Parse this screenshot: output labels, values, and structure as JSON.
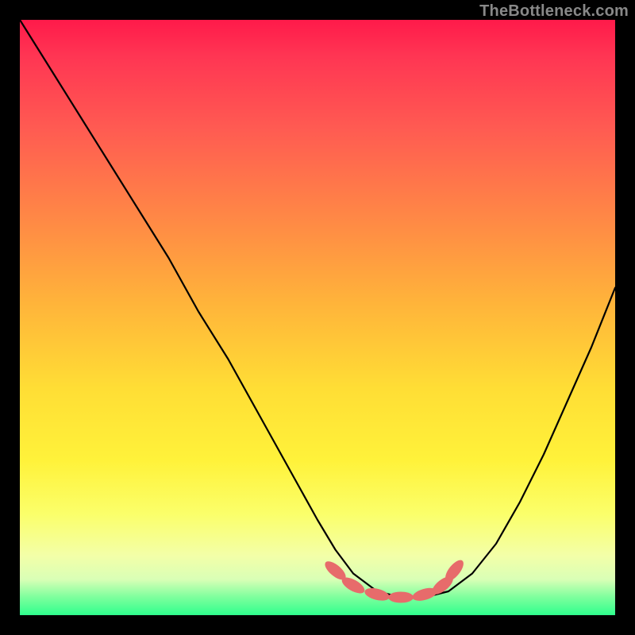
{
  "watermark": "TheBottleneck.com",
  "colors": {
    "page_bg": "#000000",
    "gradient_top": "#ff1a4a",
    "gradient_bottom": "#2fff8d",
    "curve": "#000000",
    "marker": "#e76b6b"
  },
  "chart_data": {
    "type": "line",
    "title": "",
    "xlabel": "",
    "ylabel": "",
    "xlim": [
      0,
      100
    ],
    "ylim": [
      0,
      100
    ],
    "note": "axes are unlabeled in the source image; x and y values are read as percent of plot width/height, with y=0 at the bottom (green) and y=100 at the top (red)",
    "series": [
      {
        "name": "bottleneck-curve",
        "x": [
          0,
          5,
          10,
          15,
          20,
          25,
          30,
          35,
          40,
          45,
          50,
          53,
          56,
          60,
          64,
          68,
          72,
          76,
          80,
          84,
          88,
          92,
          96,
          100
        ],
        "y": [
          100,
          92,
          84,
          76,
          68,
          60,
          51,
          43,
          34,
          25,
          16,
          11,
          7,
          4,
          3,
          3,
          4,
          7,
          12,
          19,
          27,
          36,
          45,
          55
        ]
      }
    ],
    "markers": {
      "name": "highlight-region",
      "color": "#e76b6b",
      "points": [
        {
          "x": 53,
          "y": 7.5
        },
        {
          "x": 56,
          "y": 5.0
        },
        {
          "x": 60,
          "y": 3.5
        },
        {
          "x": 64,
          "y": 3.0
        },
        {
          "x": 68,
          "y": 3.5
        },
        {
          "x": 71,
          "y": 5.0
        },
        {
          "x": 73,
          "y": 7.5
        }
      ]
    }
  }
}
